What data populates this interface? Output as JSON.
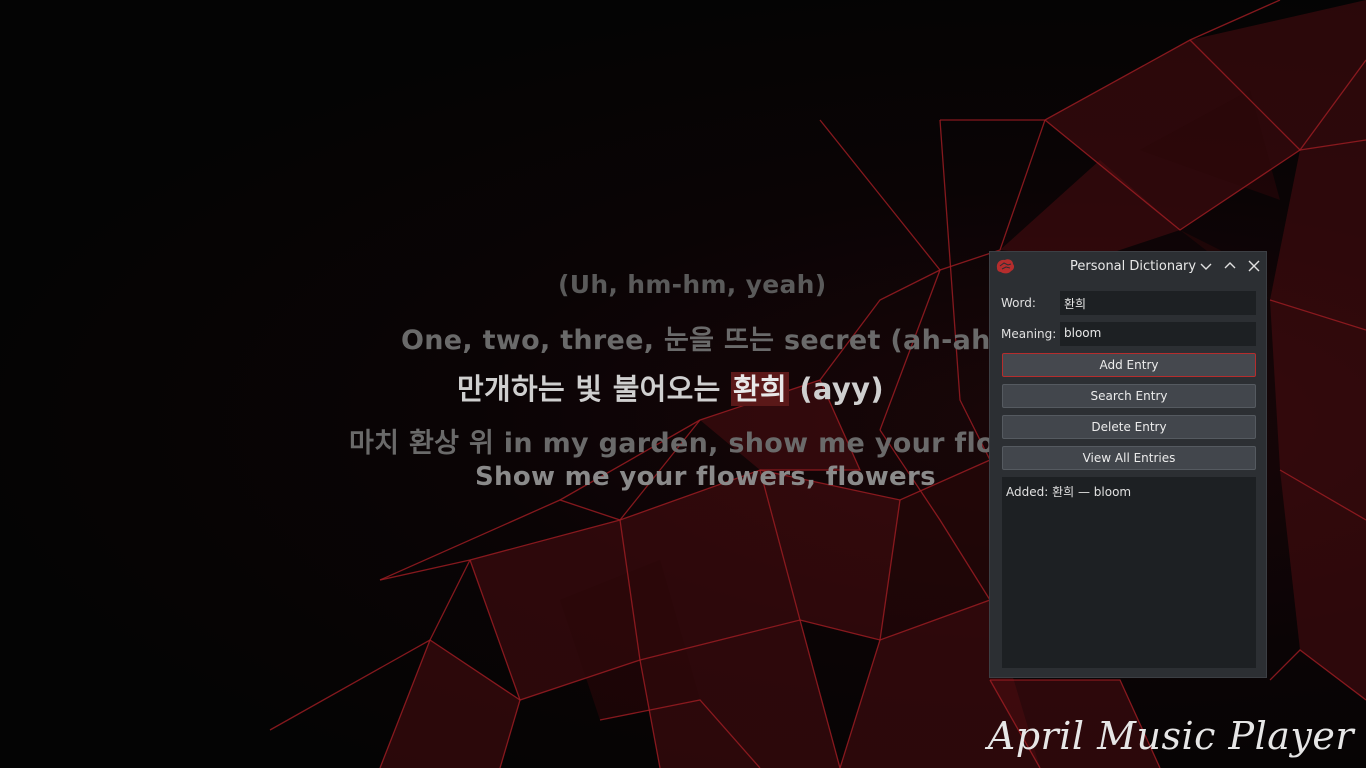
{
  "lyrics": {
    "line1": "(Uh, hm-hm, yeah)",
    "line2": "One, two, three, 눈을 뜨는 secret (ah-ah)",
    "line3_before": "만개하는 빛 불어오는 ",
    "line3_highlight": "환희",
    "line3_after": " (ayy)",
    "line4": "마치 환상 위 in my garden, show me your flowe",
    "line5": "Show me your flowers, flowers"
  },
  "brand": "April Music Player",
  "dialog": {
    "title": "Personal Dictionary",
    "word_label": "Word:",
    "word_value": "환희",
    "meaning_label": "Meaning:",
    "meaning_value": "bloom",
    "buttons": {
      "add": "Add Entry",
      "search": "Search Entry",
      "delete": "Delete Entry",
      "view_all": "View All Entries"
    },
    "log_text": "Added: 환희 — bloom"
  },
  "colors": {
    "accent": "#b52d2d",
    "highlight_bg": "#5a1818",
    "dialog_bg": "#2c2f33",
    "field_bg": "#1d2023"
  }
}
